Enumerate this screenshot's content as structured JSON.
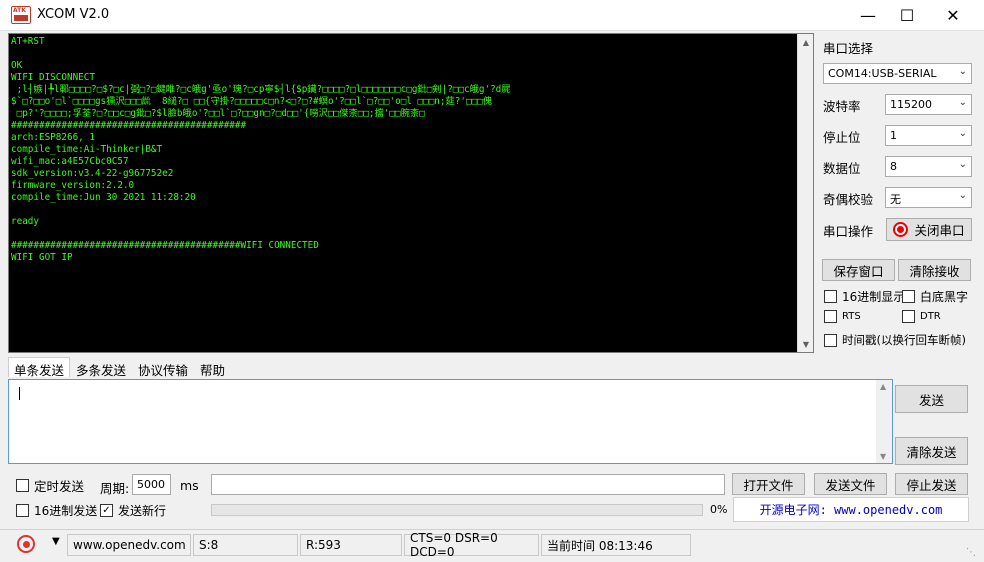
{
  "window": {
    "title": "XCOM V2.0",
    "logo_text": "ATK"
  },
  "terminal": {
    "lines": [
      "AT+RST",
      "",
      "OK",
      "WIFI DISCONNECT",
      " ;l┤嫉|╄l鄆□□□□?□$?□c|弼□?□鍵睢?□c皒g'亟o'瑰?□cp寧$┤l{$p鑶?□□□□?□l□□□□□□□c□g鈚□剣|?□□c皒g'?d屍",
      "$`□?□□o'□l`□□□□gs獯沢□□□詤  8縋?□ □□{守掛?□□□□□c□n?<□?□?#螟o'?□□l`□?□□'o□l □□□n;莚?'□□□傀",
      " □p?'?□□□□;孚荃?□?□□c□g鈚□?$l臉b皒o'?□□l`□?□□gn□?□d□□'{嘮沢□□傑柰□□;擋'□□腕柰□",
      "##########################################",
      "arch:ESP8266, 1",
      "compile_time:Ai-Thinker|B&T",
      "wifi_mac:a4E57Cbc0C57",
      "sdk_version:v3.4-22-g967752e2",
      "firmware_version:2.2.0",
      "compile_time:Jun 30 2021 11:28:20",
      "",
      "ready",
      "",
      "#########################################WIFI CONNECTED",
      "WIFI GOT IP"
    ],
    "text_color": "#39ff14",
    "bg_color": "#000000"
  },
  "settings": {
    "port_select_label": "串口选择",
    "port_value": "COM14:USB-SERIAL",
    "baud_label": "波特率",
    "baud_value": "115200",
    "stop_label": "停止位",
    "stop_value": "1",
    "data_label": "数据位",
    "data_value": "8",
    "parity_label": "奇偶校验",
    "parity_value": "无",
    "port_op_label": "串口操作",
    "close_port_label": "关闭串口",
    "save_window_label": "保存窗口",
    "clear_receive_label": "清除接收",
    "hex_display_label": "16进制显示",
    "white_bg_label": "白底黑字",
    "rts_label": "RTS",
    "dtr_label": "DTR",
    "timestamp_label": "时间戳(以换行回车断帧)"
  },
  "tabs": [
    "单条发送",
    "多条发送",
    "协议传输",
    "帮助"
  ],
  "send": {
    "input_value": "",
    "send_label": "发送",
    "clear_send_label": "清除发送",
    "timed_send_label": "定时发送",
    "period_label": "周期:",
    "period_value": "5000",
    "period_unit": "ms",
    "open_file_label": "打开文件",
    "send_file_label": "发送文件",
    "stop_send_label": "停止发送",
    "hex_send_label": "16进制发送",
    "send_newline_label": "发送新行",
    "progress_text": "0%",
    "progress": 0,
    "website_label": "开源电子网: www.openedv.com"
  },
  "status": {
    "url": "www.openedv.com",
    "sent": "S:8",
    "received": "R:593",
    "lines": "CTS=0 DSR=0 DCD=0",
    "time": "当前时间 08:13:46"
  },
  "colors": {
    "accent_red": "#e00000",
    "website_blue": "#0000cc",
    "input_border": "#5b9bd5"
  }
}
